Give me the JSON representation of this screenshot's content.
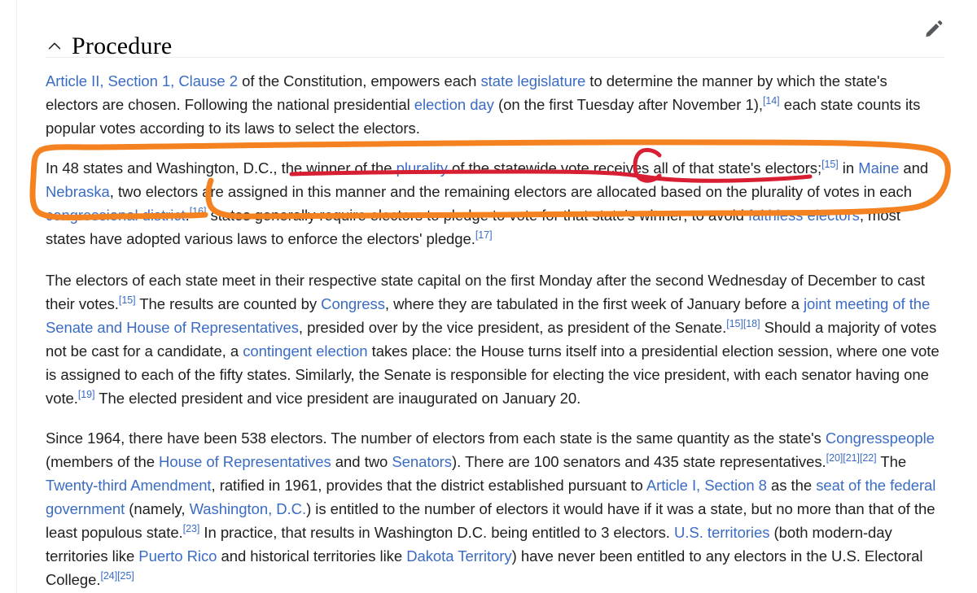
{
  "page": {
    "background_color": "#ffffff",
    "text_color": "#202122",
    "link_color": "#3b6cc4"
  },
  "section": {
    "title": "Procedure",
    "collapse_icon": "chevron-up-icon",
    "edit_icon": "pencil-edit-icon"
  },
  "paragraphs": {
    "p1": {
      "s1": "Article II, Section 1, Clause 2",
      "s2": " of the Constitution, empowers each ",
      "s3": "state legislature",
      "s4": " to determine the manner by which the state's electors are chosen. Following the national presidential ",
      "s5": "election day",
      "s6": " (on the first Tuesday after November 1),",
      "ref1": "[14]",
      "s7": " each state counts its popular votes according to its laws to select the electors."
    },
    "p2": {
      "s1": "In 48 states and Washington, D.C., the winner of the ",
      "s2": "plurality",
      "s3": " of the statewide vote receives all of that state's electors;",
      "ref1": "[15]",
      "s4": " in ",
      "s5": "Maine",
      "s6": " and ",
      "s7": "Nebraska",
      "s8": ", two electors are assigned in this manner and the remaining electors are allocated based on the plurality of votes in each ",
      "s9": "congressional district",
      "s10": ".",
      "ref2": "[16]",
      "s11": " states generally require electors to pledge to vote for that state's winner; to avoid ",
      "s12": "faithless electors",
      "s13": ", most states have adopted various laws to enforce the electors' pledge.",
      "ref3": "[17]"
    },
    "p3": {
      "s1": "The electors of each state meet in their respective state capital on the first Monday after the second Wednesday of December to cast their votes.",
      "ref1": "[15]",
      "s2": " The results are counted by ",
      "s3": "Congress",
      "s4": ", where they are tabulated in the first week of January before a ",
      "s5": "joint meeting of the Senate and House of Representatives",
      "s6": ", presided over by the vice president, as president of the Senate.",
      "ref2": "[15][18]",
      "s7": " Should a majority of votes not be cast for a candidate, a ",
      "s8": "contingent election",
      "s9": " takes place: the House turns itself into a presidential election session, where one vote is assigned to each of the fifty states. Similarly, the Senate is responsible for electing the vice president, with each senator having one vote.",
      "ref3": "[19]",
      "s10": " The elected president and vice president are inaugurated on January 20."
    },
    "p4": {
      "s1": "Since 1964, there have been 538 electors. The number of electors from each state is the same quantity as the state's ",
      "s2": "Congresspeople",
      "s3": " (members of the ",
      "s4": "House of Representatives",
      "s5": " and two ",
      "s6": "Senators",
      "s7": "). There are 100 senators and 435 state representatives.",
      "ref1": "[20][21][22]",
      "s8": " The ",
      "s9": "Twenty-third Amendment",
      "s10": ", ratified in 1961, provides that the district established pursuant to ",
      "s11": "Article I, Section 8",
      "s12": " as the ",
      "s13": "seat of the federal government",
      "s14": " (namely, ",
      "s15": "Washington, D.C.",
      "s16": ") is entitled to the number of electors it would have if it was a state, but no more than that of the least populous state.",
      "ref2": "[23]",
      "s17": " In practice, that results in Washington D.C. being entitled to 3 electors. ",
      "s18": "U.S. territories",
      "s19": " (both modern-day territories like ",
      "s20": "Puerto Rico",
      "s21": " and historical territories like ",
      "s22": "Dakota Territory",
      "s23": ") have never been entitled to any electors in the U.S. Electoral College.",
      "ref3": "[24][25]"
    }
  },
  "annotations": {
    "orange_circle": {
      "shape": "hand-drawn-ellipse-loop",
      "color": "#f58220",
      "stroke_width": 7,
      "encloses": "In 48 states and Washington, D.C., the winner of the plurality of the statewide vote receives all of that state's electors;[15] in Maine and Nebraska, two electors are assigned in this manner and the remaining electors are allocated based on the plurality of votes in each congressional district.[16]"
    },
    "red_underline": {
      "shape": "hand-drawn-underline",
      "color": "#d81e32",
      "stroke_width": 5,
      "underlines": "the winner of the plurality of the statewide vote receives all of that state's electors;"
    },
    "red_circle": {
      "shape": "hand-drawn-circle",
      "color": "#d81e32",
      "stroke_width": 5,
      "encircles": "all"
    }
  }
}
